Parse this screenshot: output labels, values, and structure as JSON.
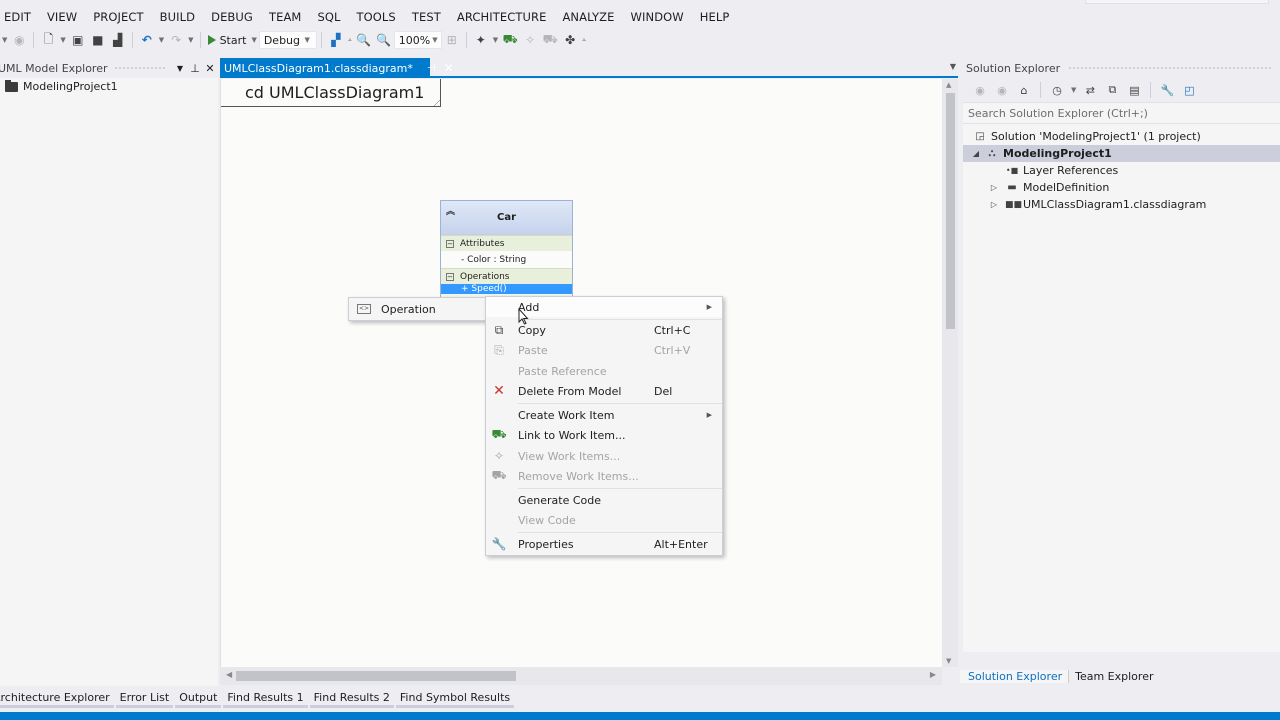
{
  "menu": [
    "EDIT",
    "VIEW",
    "PROJECT",
    "BUILD",
    "DEBUG",
    "TEAM",
    "SQL",
    "TOOLS",
    "TEST",
    "ARCHITECTURE",
    "ANALYZE",
    "WINDOW",
    "HELP"
  ],
  "toolbar": {
    "start_label": "Start",
    "config_value": "Debug",
    "zoom_value": "100%"
  },
  "left_panel": {
    "title": "UML Model Explorer",
    "items": [
      "ModelingProject1"
    ]
  },
  "document": {
    "tab_label": "UMLClassDiagram1.classdiagram*",
    "frame_label": "cd UMLClassDiagram1"
  },
  "uml_class": {
    "name": "Car",
    "attributes_label": "Attributes",
    "attributes": [
      "- Color : String"
    ],
    "operations_label": "Operations",
    "operations": [
      "+ Speed()"
    ]
  },
  "submenu": {
    "items": [
      {
        "label": "Operation",
        "icon": "operation-icon"
      }
    ]
  },
  "context_menu": {
    "items": [
      {
        "label": "Add",
        "shortcut": "",
        "icon": "",
        "disabled": false,
        "submenu": true
      },
      {
        "label": "Copy",
        "shortcut": "Ctrl+C",
        "icon": "copy-icon",
        "disabled": false
      },
      {
        "label": "Paste",
        "shortcut": "Ctrl+V",
        "icon": "paste-icon",
        "disabled": true
      },
      {
        "label": "Paste Reference",
        "shortcut": "",
        "icon": "",
        "disabled": true
      },
      {
        "label": "Delete From Model",
        "shortcut": "Del",
        "icon": "delete-icon",
        "disabled": false
      },
      {
        "label": "Create Work Item",
        "shortcut": "",
        "icon": "",
        "disabled": false,
        "submenu": true
      },
      {
        "label": "Link to Work Item...",
        "shortcut": "",
        "icon": "link-work-item-icon",
        "disabled": false
      },
      {
        "label": "View Work Items...",
        "shortcut": "",
        "icon": "view-work-items-icon",
        "disabled": true
      },
      {
        "label": "Remove Work Items...",
        "shortcut": "",
        "icon": "remove-work-items-icon",
        "disabled": true
      },
      {
        "label": "Generate Code",
        "shortcut": "",
        "icon": "",
        "disabled": false
      },
      {
        "label": "View Code",
        "shortcut": "",
        "icon": "",
        "disabled": true
      },
      {
        "label": "Properties",
        "shortcut": "Alt+Enter",
        "icon": "wrench-icon",
        "disabled": false
      }
    ]
  },
  "solution_explorer": {
    "title": "Solution Explorer",
    "search_placeholder": "Search Solution Explorer (Ctrl+;)",
    "tree": [
      {
        "label": "Solution 'ModelingProject1' (1 project)",
        "icon": "solution-icon"
      },
      {
        "label": "ModelingProject1",
        "icon": "modeling-project-icon",
        "selected": true,
        "expanded": true
      },
      {
        "label": "Layer References",
        "icon": "layer-references-icon"
      },
      {
        "label": "ModelDefinition",
        "icon": "folder-icon",
        "collapsed": true
      },
      {
        "label": "UMLClassDiagram1.classdiagram",
        "icon": "class-diagram-icon",
        "collapsed": true
      }
    ],
    "tabs": [
      "Solution Explorer",
      "Team Explorer"
    ]
  },
  "bottom_tabs": [
    "Architecture Explorer",
    "Error List",
    "Output",
    "Find Results 1",
    "Find Results 2",
    "Find Symbol Results"
  ]
}
